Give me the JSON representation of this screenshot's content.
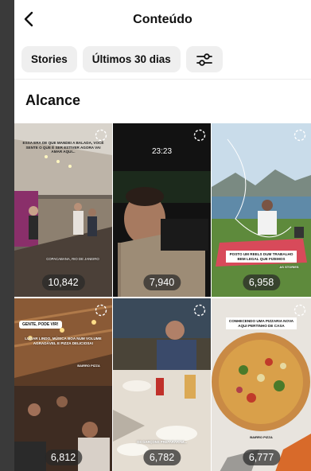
{
  "header": {
    "title": "Conteúdo"
  },
  "filters": [
    {
      "label": "Stories"
    },
    {
      "label": "Últimos 30 dias"
    }
  ],
  "section": {
    "title": "Alcance"
  },
  "tiles": [
    {
      "count": "10,842",
      "caption": "Essa era de que mandei a balada, você sente o que é ser estiver agora vai amar aqui...",
      "place": "Copacabana, Rio de Janeiro"
    },
    {
      "count": "7,940",
      "time": "23:23"
    },
    {
      "count": "6,958",
      "caption": "Posto um reels dum trabalho bem legal que fizemos",
      "tag": "As stories"
    },
    {
      "count": "6,812",
      "pill": "Gente, pode vir!",
      "caption": "Lugar lindo, música boa num volume agradável e pizza deliciosa!",
      "tag": "Bairro pizza"
    },
    {
      "count": "6,782",
      "caption": "Os garçons prepararam..."
    },
    {
      "count": "6,777",
      "caption": "Conhecendo uma pizzaria nova aqui pertinho de casa",
      "tag": "Bairro pizza"
    }
  ],
  "icons": {
    "back": "chevron-left-icon",
    "filter": "sliders-icon",
    "reel": "reel-icon"
  }
}
